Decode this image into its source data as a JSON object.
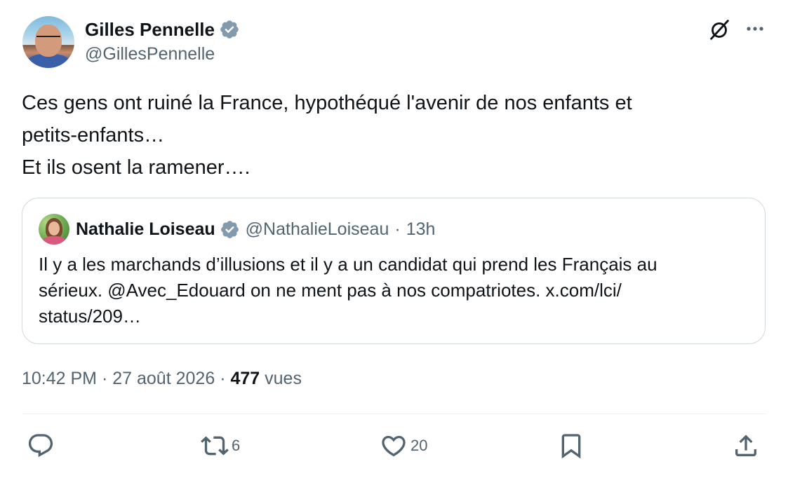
{
  "author": {
    "display_name": "Gilles Pennelle",
    "handle": "@GillesPennelle",
    "verified": true
  },
  "tweet": {
    "lines": [
      "Ces gens ont ruiné la France, hypothéqué l'avenir de nos enfants et",
      "petits-enfants…",
      "Et ils osent la ramener…."
    ]
  },
  "quote": {
    "display_name": "Nathalie Loiseau",
    "handle": "@NathalieLoiseau",
    "separator": "·",
    "time": "13h",
    "lines": [
      "Il y a les marchands d’illusions et il y a un candidat qui prend les Français au",
      "sérieux. @Avec_Edouard on ne ment pas à nos compatriotes. x.com/lci/",
      "status/209…"
    ]
  },
  "meta": {
    "time": "10:42 PM",
    "separator": "·",
    "date": "27 août 2026",
    "views_count": "477",
    "views_label": "vues"
  },
  "actions": {
    "reply_count": "",
    "retweet_count": "6",
    "like_count": "20"
  },
  "icons": {
    "verified": "verified-badge-icon",
    "grok": "grok-icon",
    "more": "more-options-icon",
    "reply": "reply-icon",
    "retweet": "retweet-icon",
    "like": "heart-icon",
    "bookmark": "bookmark-icon",
    "share": "share-icon"
  },
  "colors": {
    "text": "#0f1419",
    "secondary": "#536471",
    "border": "#cfd9de",
    "verified_badge": "#829aab"
  }
}
